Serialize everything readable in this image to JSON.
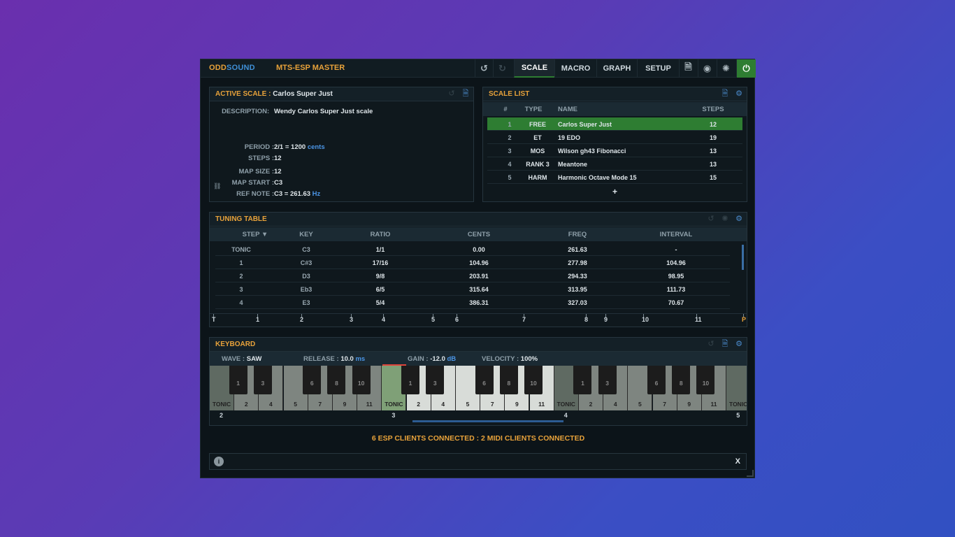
{
  "header": {
    "brand_odd": "ODD",
    "brand_sound": "SOUND",
    "title": "MTS-ESP MASTER",
    "tabs": [
      "SCALE",
      "MACRO",
      "GRAPH",
      "SETUP"
    ],
    "active_tab": "SCALE",
    "icons": [
      "undo-icon",
      "redo-icon",
      "document-icon",
      "eye-icon",
      "midi-icon",
      "power-icon"
    ]
  },
  "active_scale": {
    "title_label": "ACTIVE SCALE :",
    "title_value": "Carlos Super Just",
    "description_label": "DESCRIPTION",
    "description_value": "Wendy Carlos Super Just scale",
    "period_label": "PERIOD",
    "period_value": "2/1 = 1200",
    "period_unit": "cents",
    "steps_label": "STEPS",
    "steps_value": "12",
    "map_size_label": "MAP SIZE",
    "map_size_value": "12",
    "map_start_label": "MAP START",
    "map_start_value": "C3",
    "ref_note_label": "REF NOTE",
    "ref_note_value": "C3 = 261.63",
    "ref_note_unit": "Hz"
  },
  "scale_list": {
    "title": "SCALE LIST",
    "columns": [
      "#",
      "TYPE",
      "NAME",
      "STEPS"
    ],
    "rows": [
      {
        "num": "1",
        "type": "FREE",
        "name": "Carlos Super Just",
        "steps": "12",
        "selected": true
      },
      {
        "num": "2",
        "type": "ET",
        "name": "19 EDO",
        "steps": "19",
        "selected": false
      },
      {
        "num": "3",
        "type": "MOS",
        "name": "Wilson gh43 Fibonacci",
        "steps": "13",
        "selected": false
      },
      {
        "num": "4",
        "type": "RANK 3",
        "name": "Meantone",
        "steps": "13",
        "selected": false
      },
      {
        "num": "5",
        "type": "HARM",
        "name": "Harmonic Octave Mode 15",
        "steps": "15",
        "selected": false
      }
    ],
    "add_label": "+"
  },
  "tuning_table": {
    "title": "TUNING TABLE",
    "columns": [
      "STEP ▼",
      "KEY",
      "RATIO",
      "CENTS",
      "FREQ",
      "INTERVAL"
    ],
    "rows": [
      [
        "TONIC",
        "C3",
        "1/1",
        "0.00",
        "261.63",
        "-"
      ],
      [
        "1",
        "C#3",
        "17/16",
        "104.96",
        "277.98",
        "104.96"
      ],
      [
        "2",
        "D3",
        "9/8",
        "203.91",
        "294.33",
        "98.95"
      ],
      [
        "3",
        "Eb3",
        "6/5",
        "315.64",
        "313.95",
        "111.73"
      ],
      [
        "4",
        "E3",
        "5/4",
        "386.31",
        "327.03",
        "70.67"
      ]
    ],
    "ruler": [
      "T",
      "1",
      "2",
      "3",
      "4",
      "5",
      "6",
      "7",
      "8",
      "9",
      "10",
      "11",
      "P"
    ]
  },
  "keyboard": {
    "title": "KEYBOARD",
    "wave_label": "WAVE",
    "wave_value": "SAW",
    "release_label": "RELEASE",
    "release_value": "10.0",
    "release_unit": "ms",
    "gain_label": "GAIN",
    "gain_value": "-12.0",
    "gain_unit": "dB",
    "velocity_label": "VELOCITY",
    "velocity_value": "100%",
    "white_labels": [
      "TONIC",
      "2",
      "4",
      "5",
      "7",
      "9",
      "11"
    ],
    "black_labels": [
      "1",
      "3",
      "6",
      "8",
      "10"
    ],
    "octaves": [
      "2",
      "3",
      "4",
      "5"
    ]
  },
  "status": "6 ESP CLIENTS CONNECTED : 2 MIDI CLIENTS CONNECTED",
  "message_bar": {
    "info": "i",
    "close": "X"
  }
}
